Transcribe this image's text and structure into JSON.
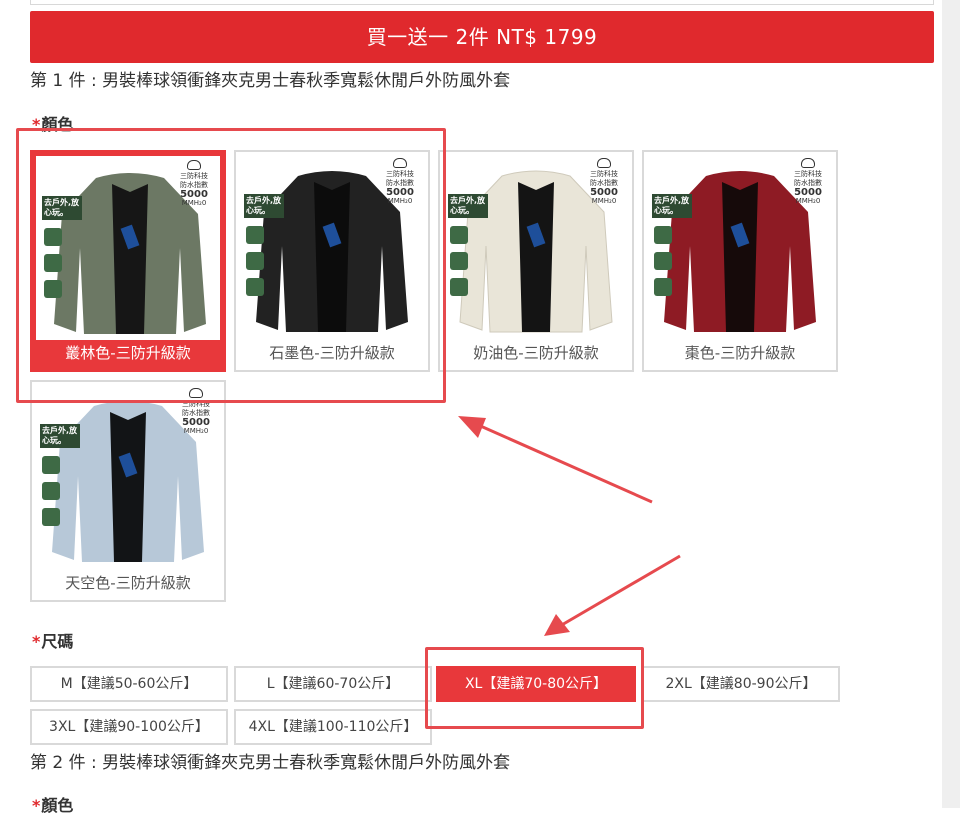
{
  "buy_button": {
    "label": "買一送一 2件 NT$ 1799"
  },
  "item1": {
    "title": "第 1 件 : 男裝棒球領衝鋒夾克男士春秋季寬鬆休閒戶外防風外套"
  },
  "item2": {
    "title": "第 2 件 : 男裝棒球領衝鋒夾克男士春秋季寬鬆休閒戶外防風外套"
  },
  "color_section": {
    "required_mark": "*",
    "label": "顏色"
  },
  "size_section": {
    "required_mark": "*",
    "label": "尺碼"
  },
  "product_badge": {
    "tech": "三防科技",
    "index_label": "防水指數",
    "index_value": "5000",
    "index_unit": "MMH₂0",
    "slogan": "去戶外,放心玩。"
  },
  "colors": [
    {
      "label": "叢林色-三防升級款",
      "jacket_color": "#6c7864",
      "selected": true
    },
    {
      "label": "石墨色-三防升級款",
      "jacket_color": "#222222",
      "selected": false
    },
    {
      "label": "奶油色-三防升級款",
      "jacket_color": "#e9e5d8",
      "selected": false
    },
    {
      "label": "棗色-三防升級款",
      "jacket_color": "#8e1b24",
      "selected": false
    },
    {
      "label": "天空色-三防升級款",
      "jacket_color": "#b7c8d8",
      "selected": false
    }
  ],
  "sizes": [
    {
      "label": "M【建議50-60公斤】",
      "selected": false
    },
    {
      "label": "L【建議60-70公斤】",
      "selected": false
    },
    {
      "label": "XL【建議70-80公斤】",
      "selected": true
    },
    {
      "label": "2XL【建議80-90公斤】",
      "selected": false
    },
    {
      "label": "3XL【建議90-100公斤】",
      "selected": false
    },
    {
      "label": "4XL【建議100-110公斤】",
      "selected": false
    }
  ],
  "theme": {
    "accent": "#e8383b",
    "annotation": "#e64a4e"
  }
}
